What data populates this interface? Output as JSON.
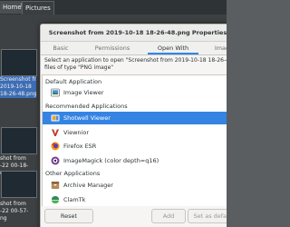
{
  "file_manager": {
    "breadcrumbs": [
      "Home",
      "Pictures"
    ],
    "labels": [
      [
        "Screenshot from",
        "2019-10-18",
        "18-26-48.png"
      ],
      [
        "shot from",
        "-22 00-18-",
        "ng"
      ],
      [
        "shot from",
        "-22 00-57-",
        "ng"
      ]
    ]
  },
  "dialog": {
    "title": "Screenshot from 2019-10-18 18-26-48.png Properties",
    "tabs": [
      "Basic",
      "Permissions",
      "Open With",
      "Image"
    ],
    "description": [
      "Select an application to open \"Screenshot from 2019-10-18 18-26-48.png\" and other",
      "files of type \"PNG image\""
    ],
    "sections": {
      "default": "Default Application",
      "recommended": "Recommended Applications",
      "other": "Other Applications"
    },
    "default_apps": [
      {
        "name": "Image Viewer",
        "icon": "image-viewer-icon"
      }
    ],
    "recommended_apps": [
      {
        "name": "Shotwell Viewer",
        "icon": "shotwell-icon",
        "selected": true
      },
      {
        "name": "Viewnior",
        "icon": "viewnior-icon"
      },
      {
        "name": "Firefox ESR",
        "icon": "firefox-icon"
      },
      {
        "name": "ImageMagick (color depth=q16)",
        "icon": "imagemagick-icon"
      }
    ],
    "other_apps": [
      {
        "name": "Archive Manager",
        "icon": "archive-manager-icon"
      },
      {
        "name": "ClamTk",
        "icon": "clamtk-icon"
      }
    ],
    "buttons": {
      "reset": "Reset",
      "add": "Add",
      "set_default": "Set as default"
    }
  },
  "colors": {
    "accent": "#3584e4",
    "dialog_bg": "#f6f5f4",
    "fm_bg": "#3d4143"
  }
}
